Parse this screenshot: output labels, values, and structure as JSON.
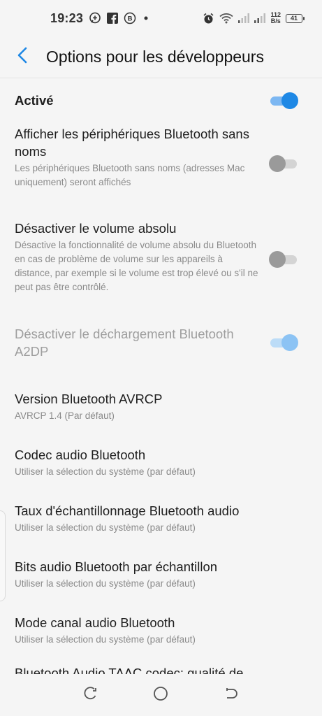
{
  "status": {
    "time": "19:23",
    "net_speed_value": "112",
    "net_speed_unit": "B/s",
    "battery": "41"
  },
  "header": {
    "title": "Options pour les développeurs"
  },
  "items": [
    {
      "title": "Activé",
      "subtitle": "",
      "toggle": "on"
    },
    {
      "title": "Afficher les périphériques Bluetooth sans noms",
      "subtitle": "Les périphériques Bluetooth sans noms (adresses Mac uniquement) seront affichés",
      "toggle": "off"
    },
    {
      "title": "Désactiver le volume absolu",
      "subtitle": "Désactive la fonctionnalité de volume absolu du Bluetooth en cas de problème de volume sur les appareils à distance, par exemple si le volume est trop élevé ou s'il ne peut pas être contrôlé.",
      "toggle": "off"
    },
    {
      "title": "Désactiver le déchargement Bluetooth A2DP",
      "subtitle": "",
      "toggle": "on",
      "disabled": true
    },
    {
      "title": "Version Bluetooth AVRCP",
      "subtitle": "AVRCP 1.4 (Par défaut)"
    },
    {
      "title": "Codec audio Bluetooth",
      "subtitle": "Utiliser la sélection du système (par défaut)"
    },
    {
      "title": "Taux d'échantillonnage Bluetooth audio",
      "subtitle": "Utiliser la sélection du système (par défaut)"
    },
    {
      "title": "Bits audio Bluetooth par échantillon",
      "subtitle": "Utiliser la sélection du système (par défaut)"
    },
    {
      "title": "Mode canal audio Bluetooth",
      "subtitle": "Utiliser la sélection du système (par défaut)"
    },
    {
      "title": "Bluetooth Audio TAAC codec: qualité de",
      "subtitle": ""
    }
  ],
  "colors": {
    "accent": "#1e88e5",
    "background": "#f5f5f5"
  },
  "icons": {
    "back": "arrow-left-icon",
    "nav_back": "nav-back-icon",
    "nav_home": "nav-home-icon",
    "nav_recents": "nav-recents-icon"
  }
}
